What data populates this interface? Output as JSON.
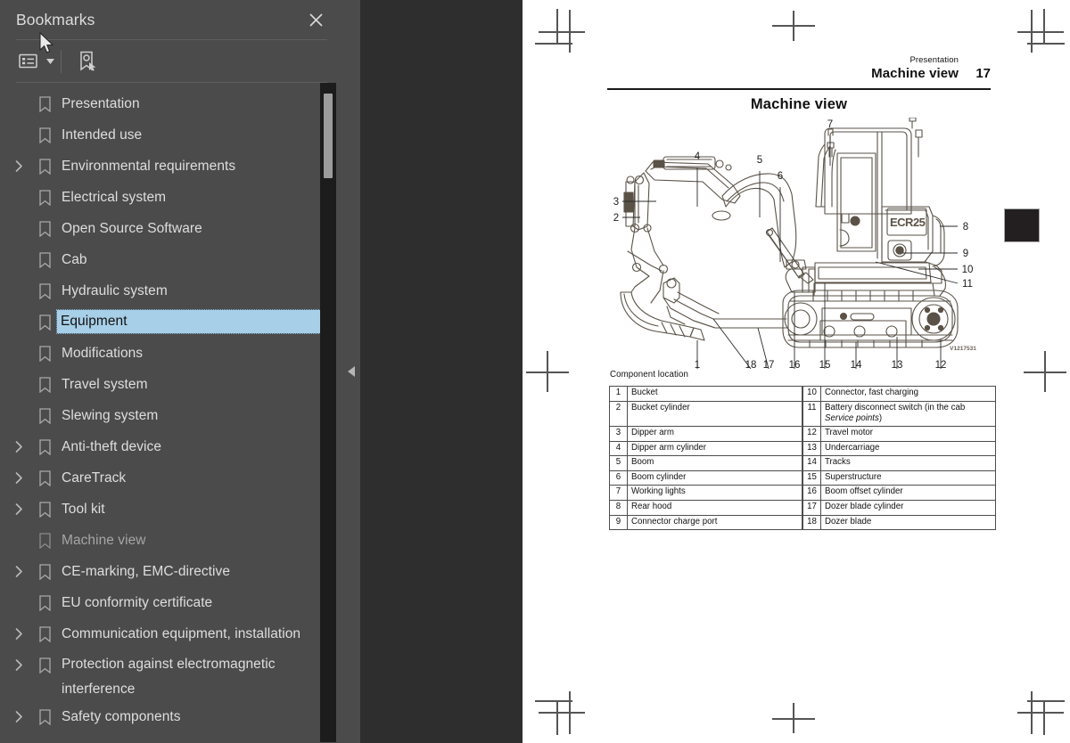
{
  "sidebar": {
    "title": "Bookmarks",
    "close_icon": "close-icon",
    "toolbar": {
      "options_icon": "bookmark-options-icon",
      "caret_icon": "chevron-down-icon",
      "new_bookmark_icon": "new-bookmark-icon"
    },
    "items": [
      {
        "label": "Presentation",
        "expandable": false,
        "selected": false,
        "dim": false
      },
      {
        "label": "Intended use",
        "expandable": false,
        "selected": false,
        "dim": false
      },
      {
        "label": "Environmental requirements",
        "expandable": true,
        "selected": false,
        "dim": false
      },
      {
        "label": "Electrical system",
        "expandable": false,
        "selected": false,
        "dim": false
      },
      {
        "label": "Open Source Software",
        "expandable": false,
        "selected": false,
        "dim": false
      },
      {
        "label": "Cab",
        "expandable": false,
        "selected": false,
        "dim": false
      },
      {
        "label": "Hydraulic system",
        "expandable": false,
        "selected": false,
        "dim": false
      },
      {
        "label": "Equipment",
        "expandable": false,
        "selected": true,
        "dim": false
      },
      {
        "label": "Modifications",
        "expandable": false,
        "selected": false,
        "dim": false
      },
      {
        "label": "Travel system",
        "expandable": false,
        "selected": false,
        "dim": false
      },
      {
        "label": "Slewing system",
        "expandable": false,
        "selected": false,
        "dim": false
      },
      {
        "label": "Anti-theft device",
        "expandable": true,
        "selected": false,
        "dim": false
      },
      {
        "label": "CareTrack",
        "expandable": true,
        "selected": false,
        "dim": false
      },
      {
        "label": "Tool kit",
        "expandable": true,
        "selected": false,
        "dim": false
      },
      {
        "label": "Machine view",
        "expandable": false,
        "selected": false,
        "dim": true
      },
      {
        "label": "CE-marking, EMC-directive",
        "expandable": true,
        "selected": false,
        "dim": false
      },
      {
        "label": "EU conformity certificate",
        "expandable": false,
        "selected": false,
        "dim": false
      },
      {
        "label": "Communication equipment, installation",
        "expandable": true,
        "selected": false,
        "dim": false
      },
      {
        "label": "Protection against electromagnetic\ninterference",
        "expandable": true,
        "selected": false,
        "dim": false,
        "tall": true
      },
      {
        "label": "Safety components",
        "expandable": true,
        "selected": false,
        "dim": false
      }
    ]
  },
  "viewer": {
    "collapse_handle_icon": "triangle-left-icon"
  },
  "page": {
    "header": {
      "chapter": "Presentation",
      "section": "Machine view",
      "page_number": "17"
    },
    "title": "Machine view",
    "figure": {
      "ref_code": "V1217531",
      "callouts": [
        "1",
        "2",
        "3",
        "4",
        "5",
        "6",
        "7",
        "8",
        "9",
        "10",
        "11",
        "12",
        "13",
        "14",
        "15",
        "16",
        "17",
        "18"
      ],
      "cab_badge": "ECR25"
    },
    "table": {
      "caption": "Component location",
      "rows": [
        {
          "n1": "1",
          "t1": "Bucket",
          "n2": "10",
          "t2": "Connector, fast charging"
        },
        {
          "n1": "2",
          "t1": "Bucket cylinder",
          "n2": "11",
          "t2": "Battery disconnect switch (in the cab ",
          "t2_italic": "Service points",
          "t2_tail": ")"
        },
        {
          "n1": "3",
          "t1": "Dipper arm",
          "n2": "12",
          "t2": "Travel motor"
        },
        {
          "n1": "4",
          "t1": "Dipper arm cylinder",
          "n2": "13",
          "t2": "Undercarriage"
        },
        {
          "n1": "5",
          "t1": "Boom",
          "n2": "14",
          "t2": "Tracks"
        },
        {
          "n1": "6",
          "t1": "Boom cylinder",
          "n2": "15",
          "t2": "Superstructure"
        },
        {
          "n1": "7",
          "t1": "Working lights",
          "n2": "16",
          "t2": "Boom offset cylinder"
        },
        {
          "n1": "8",
          "t1": "Rear hood",
          "n2": "17",
          "t2": "Dozer blade cylinder"
        },
        {
          "n1": "9",
          "t1": "Connector charge port",
          "n2": "18",
          "t2": "Dozer blade"
        }
      ]
    }
  },
  "colors": {
    "sidebar_bg": "#4b4b4b",
    "gutter_bg": "#2e2e2e",
    "page_bg": "#ffffff",
    "selection": "#a8cfe8",
    "text": "#dedede",
    "scrollbar_track": "#1c1c1c",
    "scrollbar_thumb": "#9d9d9d",
    "ink": "#5a5247"
  }
}
